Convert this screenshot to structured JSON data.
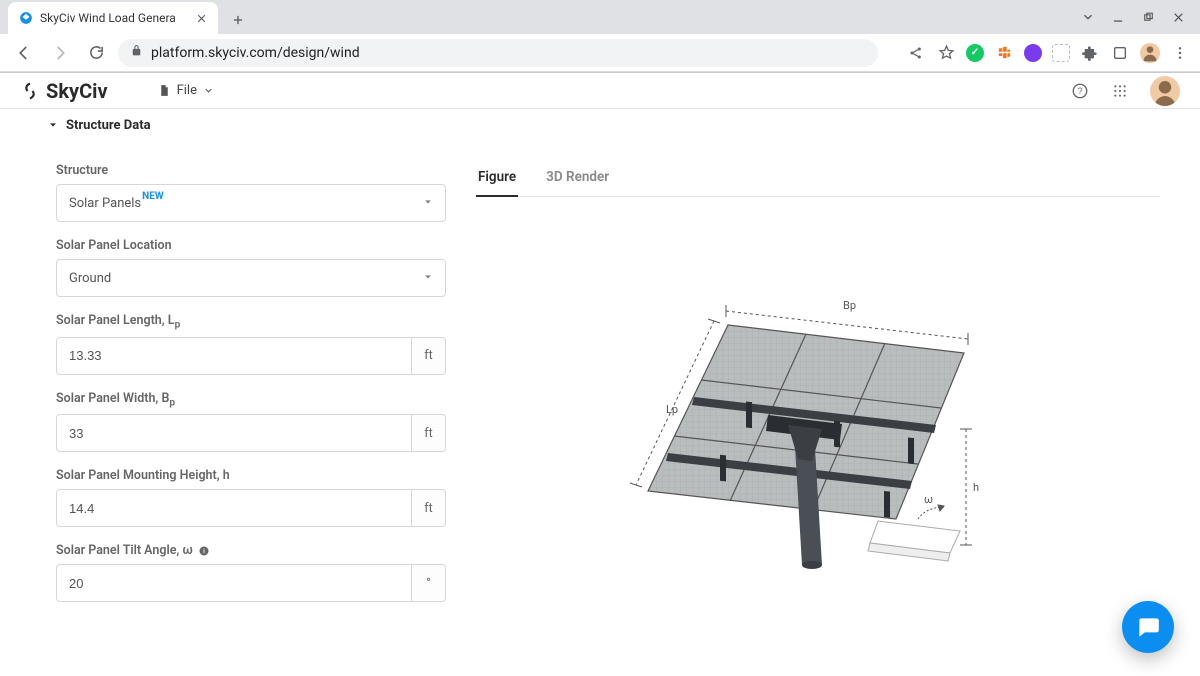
{
  "browser": {
    "tab_title": "SkyCiv Wind Load Genera",
    "url": "platform.skyciv.com/design/wind"
  },
  "app_header": {
    "brand": "SkyCiv",
    "file_label": "File"
  },
  "section": {
    "title": "Structure Data"
  },
  "form": {
    "structure": {
      "label": "Structure",
      "value": "Solar Panels",
      "new_badge": "NEW"
    },
    "location": {
      "label": "Solar Panel Location",
      "value": "Ground"
    },
    "length": {
      "label_pre": "Solar Panel Length, L",
      "label_sub": "p",
      "value": "13.33",
      "unit": "ft"
    },
    "width": {
      "label_pre": "Solar Panel Width, B",
      "label_sub": "p",
      "value": "33",
      "unit": "ft"
    },
    "height": {
      "label": "Solar Panel Mounting Height, h",
      "value": "14.4",
      "unit": "ft"
    },
    "tilt": {
      "label": "Solar Panel Tilt Angle, ω",
      "value": "20",
      "unit": "°"
    }
  },
  "viz": {
    "tab_figure": "Figure",
    "tab_3d": "3D Render",
    "dims": {
      "Bp": "Bp",
      "Lp": "Lp",
      "h": "h",
      "omega": "ω"
    }
  }
}
